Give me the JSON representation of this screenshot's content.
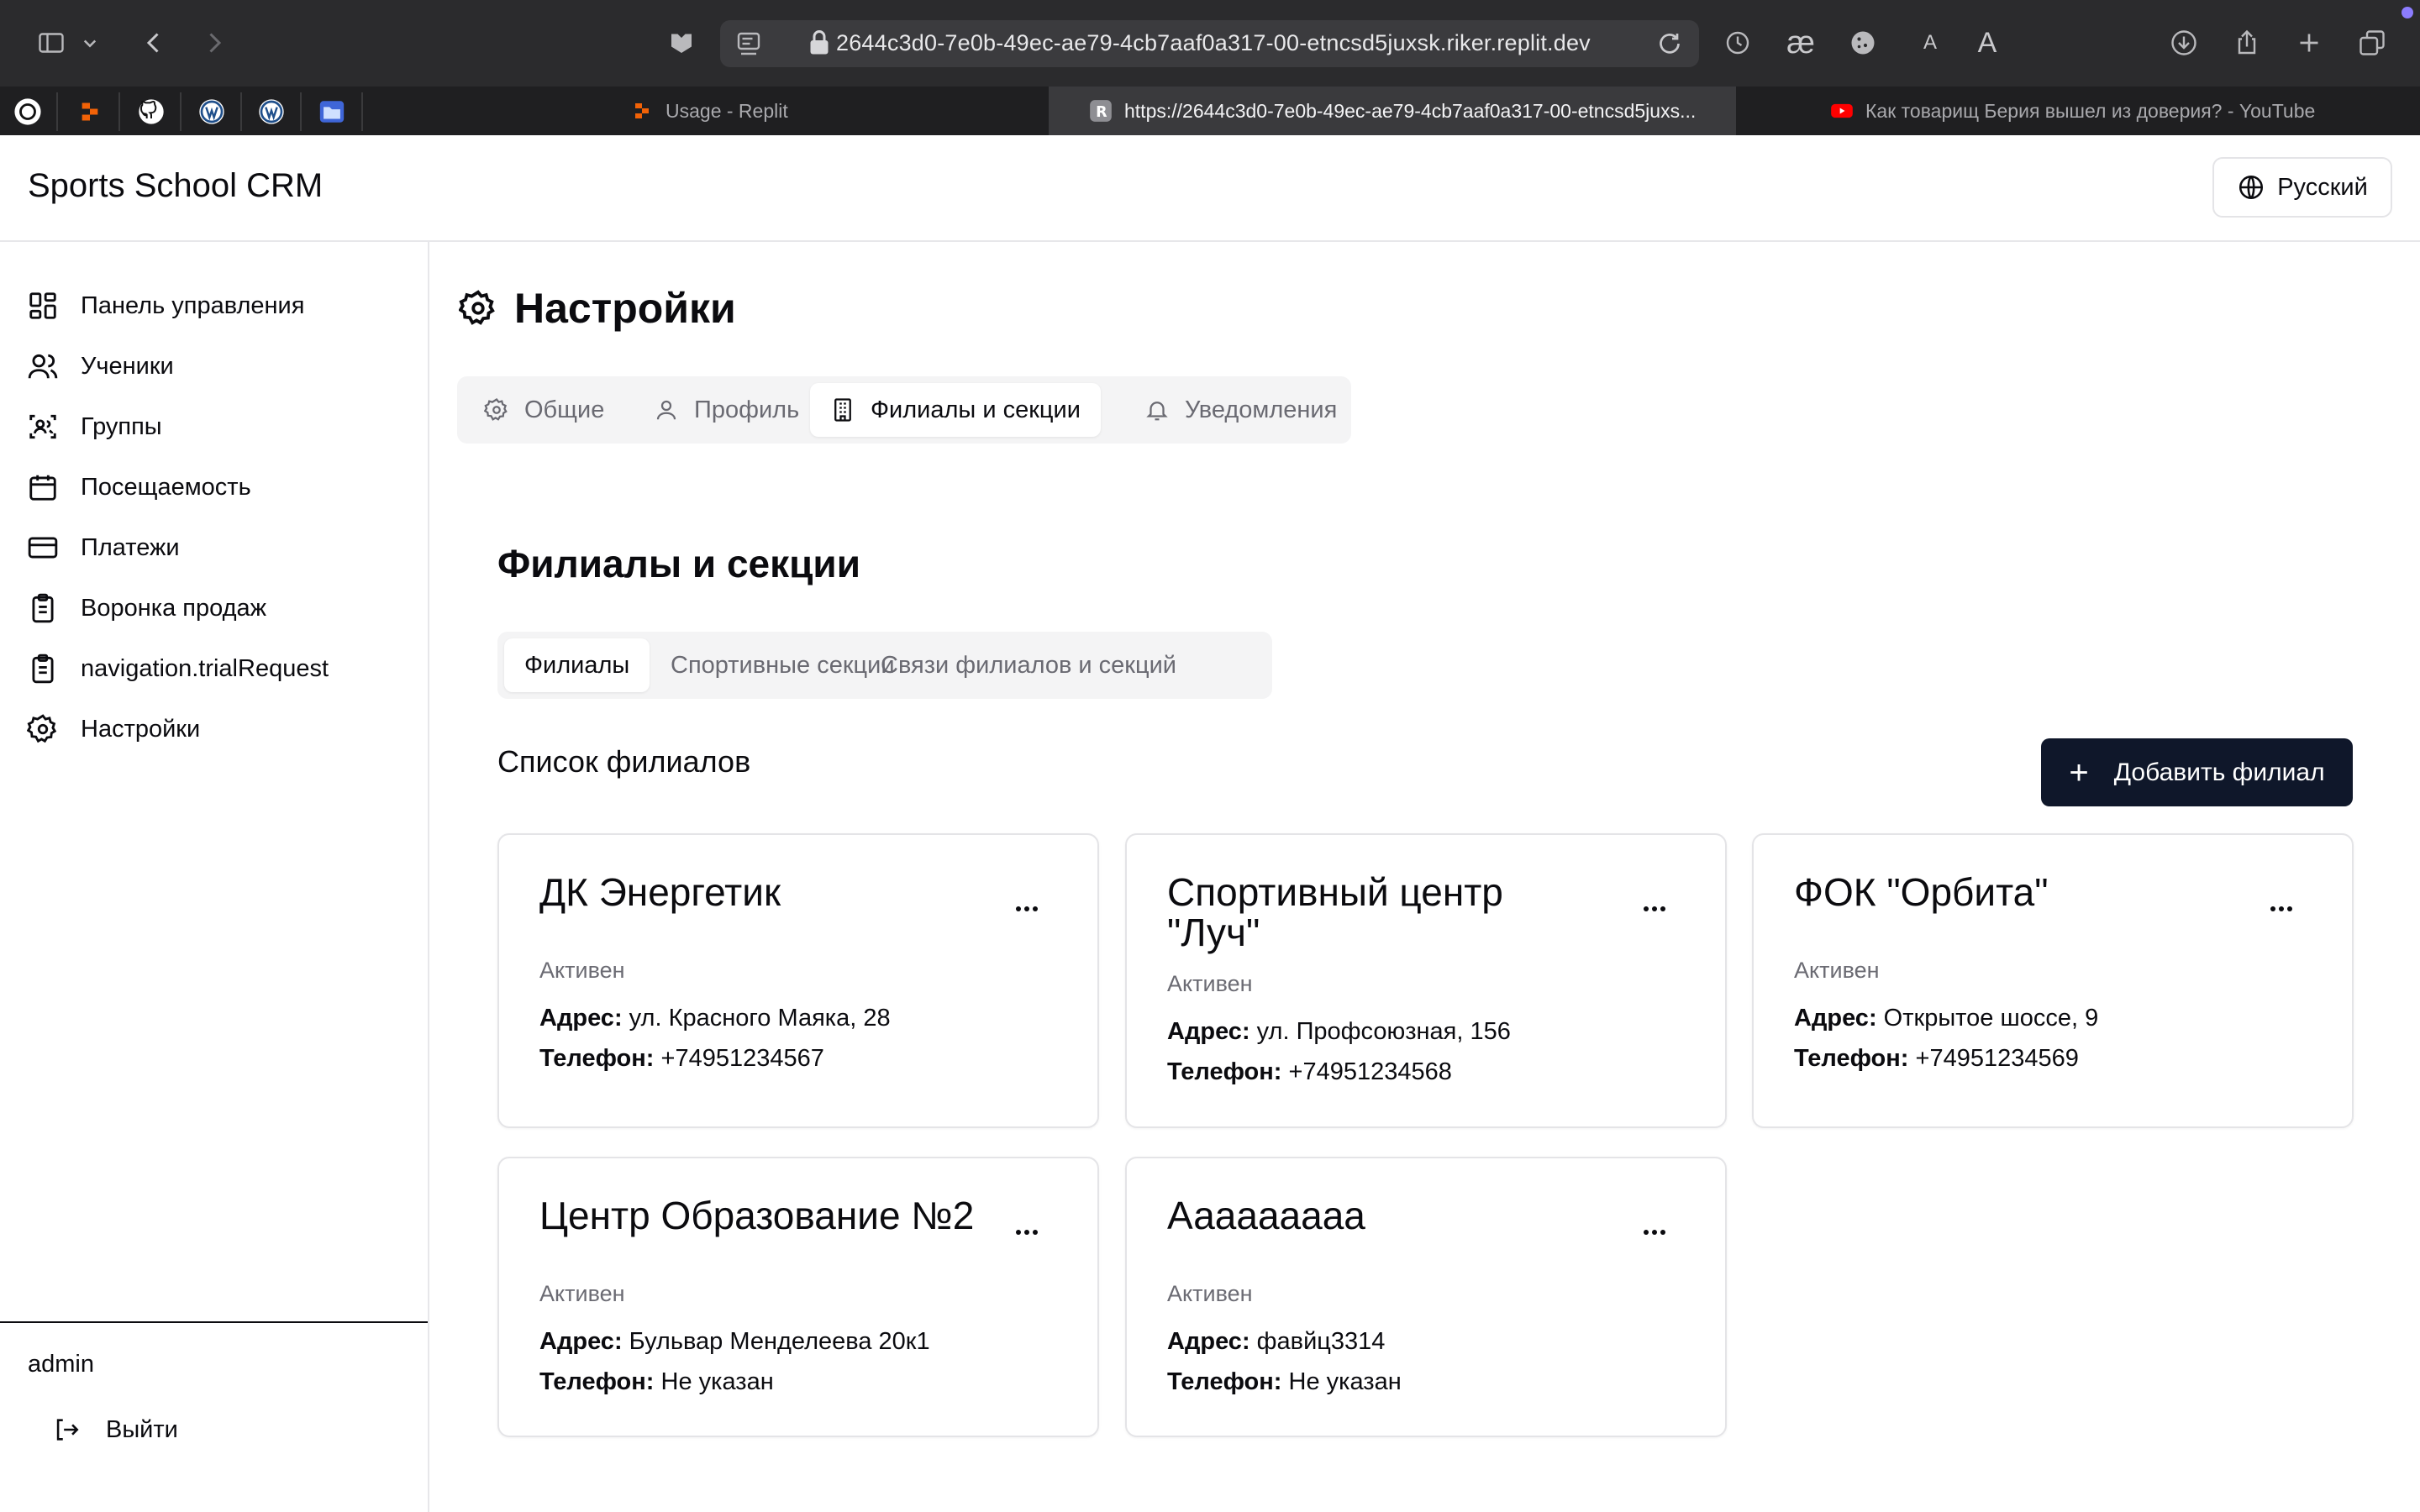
{
  "browser": {
    "url": "2644c3d0-7e0b-49ec-ae79-4cb7aaf0a317-00-etncsd5juxsk.riker.replit.dev",
    "toolbar_icons": [
      "sidebar-icon",
      "chevron-down-icon",
      "back-icon",
      "forward-icon",
      "extension-icon",
      "reader-icon",
      "lock-icon",
      "reload-icon",
      "history-icon",
      "ae-icon",
      "cookie-icon",
      "text-smaller-icon",
      "text-larger-icon",
      "download-icon",
      "share-icon",
      "new-tab-icon",
      "tabs-overview-icon"
    ],
    "font_small": "A",
    "font_large": "A",
    "ae_glyph": "æ",
    "tabs": [
      {
        "title": "Usage - Replit",
        "icon": "replit-icon"
      },
      {
        "title": "https://2644c3d0-7e0b-49ec-ae79-4cb7aaf0a317-00-etncsd5juxs...",
        "icon": "replit-r-icon",
        "active": true
      },
      {
        "title": "Как товарищ Берия вышел из доверия? - YouTube",
        "icon": "youtube-icon"
      }
    ],
    "pinned_tabs": [
      "openai-icon",
      "replit-icon",
      "github-icon",
      "wordpress-icon",
      "wordpress-icon",
      "folder-icon"
    ]
  },
  "header": {
    "title": "Sports School CRM",
    "language_button": "Русский"
  },
  "sidebar": {
    "items": [
      {
        "label": "Панель управления",
        "icon": "dashboard-icon"
      },
      {
        "label": "Ученики",
        "icon": "users-icon"
      },
      {
        "label": "Группы",
        "icon": "groups-icon"
      },
      {
        "label": "Посещаемость",
        "icon": "calendar-icon"
      },
      {
        "label": "Платежи",
        "icon": "credit-card-icon"
      },
      {
        "label": "Воронка продаж",
        "icon": "clipboard-icon"
      },
      {
        "label": "navigation.trialRequest",
        "icon": "clipboard-icon"
      },
      {
        "label": "Настройки",
        "icon": "gear-icon"
      }
    ],
    "user": "admin",
    "logout": "Выйти"
  },
  "main": {
    "title": "Настройки",
    "settings_tabs": [
      {
        "label": "Общие",
        "icon": "gear-icon"
      },
      {
        "label": "Профиль",
        "icon": "user-icon"
      },
      {
        "label": "Филиалы и секции",
        "icon": "building-icon",
        "active": true
      },
      {
        "label": "Уведомления",
        "icon": "bell-icon"
      }
    ],
    "section_title": "Филиалы и секции",
    "sub_tabs": [
      {
        "label": "Филиалы",
        "active": true
      },
      {
        "label": "Спортивные секции"
      },
      {
        "label": "Связи филиалов и секций"
      }
    ],
    "list_title": "Список филиалов",
    "add_button": "Добавить филиал",
    "address_label": "Адрес:",
    "phone_label": "Телефон:",
    "branches": [
      {
        "name": "ДК Энергетик",
        "status": "Активен",
        "address": "ул. Красного Маяка, 28",
        "phone": "+74951234567"
      },
      {
        "name": "Спортивный центр \"Луч\"",
        "status": "Активен",
        "address": "ул. Профсоюзная, 156",
        "phone": "+74951234568"
      },
      {
        "name": "ФОК \"Орбита\"",
        "status": "Активен",
        "address": "Открытое шоссе, 9",
        "phone": "+74951234569"
      },
      {
        "name": "Центр Образование №2",
        "status": "Активен",
        "address": "Бульвар Менделеева 20к1",
        "phone": "Не указан"
      },
      {
        "name": "Ааааааааа",
        "status": "Активен",
        "address": "фавйц3314",
        "phone": "Не указан"
      }
    ]
  }
}
